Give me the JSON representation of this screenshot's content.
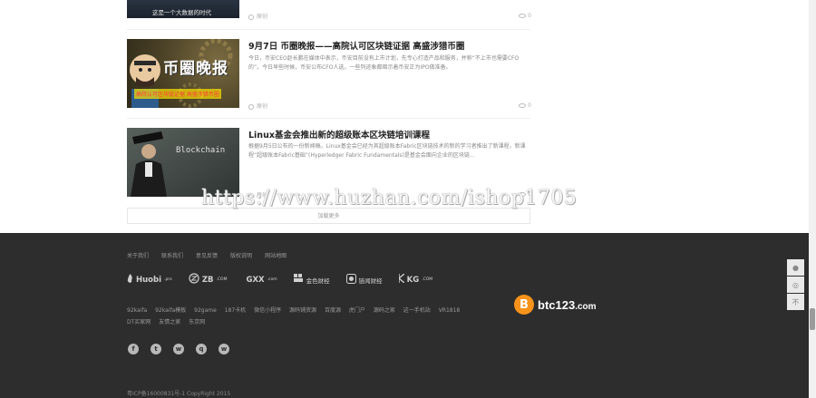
{
  "articles": [
    {
      "thumb_caption": "这是一个大数据的时代",
      "meta_left": "原创",
      "views": "0"
    },
    {
      "title": "9月7日 币圈晚报——高院认可区块链证据 高盛涉猎币圈",
      "desc": "今日，币安CEO赵长鹏在媒体中表示，币安目前没有上市计划，先专心打造产品和服务，并称“不上市也需要CFO的”。今日早些时候，币安公布CFO人选，一些列迹象都暗示着币安正为IPO做准备。",
      "thumb_banner": "币圈晚报",
      "thumb_sub": "高院认可区块链证据 高盛涉猎币圈",
      "meta_left": "原创",
      "views": "0"
    },
    {
      "title": "Linux基金会推出新的超级账本区块链培训课程",
      "desc": "根据9月5日公布的一份新闻稿，Linux基金会已经为其超级账本Fabric区块链技术的新的学习者推出了新课程，新课程“超级账本Fabric基础”(Hyperledger Fabric Fundamentals)是基金会面向企业的区块链...",
      "thumb_board": "Blockchain",
      "meta_left": "原创",
      "views": "0"
    }
  ],
  "load_more": "加载更多",
  "watermark": "https://www.huzhan.com/ishop1705",
  "footer": {
    "nav": [
      "关于我们",
      "联系我们",
      "意见反馈",
      "版权说明",
      "网站地图"
    ],
    "partners": [
      {
        "name": "Huobi",
        "suffix": ".pro",
        "icon": "huobi-flame-icon"
      },
      {
        "name": "ZB",
        "suffix": ".COM",
        "icon": "zb-circle-icon"
      },
      {
        "name": "GXX",
        "suffix": ".com",
        "icon": "gxx-logo-icon"
      },
      {
        "name": "金色财经",
        "suffix": "",
        "icon": "jinse-logo-icon"
      },
      {
        "name": "链闻财经",
        "suffix": "",
        "icon": "lianwen-logo-icon"
      },
      {
        "name": "KG",
        "suffix": ".COM",
        "icon": "kg-logo-icon"
      }
    ],
    "links": [
      "92kaifa",
      "92kaifa模板",
      "92game",
      "187卡机",
      "微信小程序",
      "源码铺资源",
      "百度源",
      "虎门户",
      "源码之家",
      "这一手机站",
      "VR1818",
      "DT买家网",
      "友情之家",
      "东京网"
    ],
    "brand": {
      "name": "btc123",
      "suffix": ".com",
      "coin": "B"
    },
    "social": [
      {
        "icon": "facebook-icon",
        "glyph": "f"
      },
      {
        "icon": "twitter-icon",
        "glyph": "t"
      },
      {
        "icon": "wechat-icon",
        "glyph": "w"
      },
      {
        "icon": "qq-icon",
        "glyph": "q"
      },
      {
        "icon": "weibo-icon",
        "glyph": "w"
      }
    ],
    "icp": "粤ICP备16000831号-1 CopyRight 2015"
  },
  "sidebar": {
    "items": [
      {
        "icon": "qq-icon",
        "glyph": "●"
      },
      {
        "icon": "wechat-icon",
        "glyph": "◎"
      },
      {
        "icon": "back-to-top-icon",
        "glyph": "不"
      }
    ]
  }
}
